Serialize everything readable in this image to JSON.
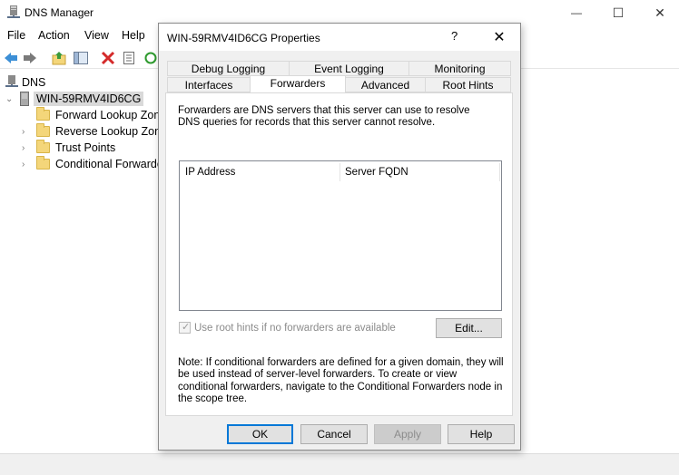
{
  "app": {
    "title": "DNS Manager",
    "min_glyph": "—",
    "max_glyph": "☐",
    "close_glyph": "✕"
  },
  "menu": [
    "File",
    "Action",
    "View",
    "Help"
  ],
  "tree": {
    "root": "DNS",
    "server": "WIN-59RMV4ID6CG",
    "folders": [
      "Forward Lookup Zones",
      "Reverse Lookup Zones",
      "Trust Points",
      "Conditional Forwarders"
    ]
  },
  "dialog": {
    "title": "WIN-59RMV4ID6CG Properties",
    "help_glyph": "?",
    "close_glyph": "✕",
    "tabs_row1": [
      "Debug Logging",
      "Event Logging",
      "Monitoring"
    ],
    "tabs_row2": [
      "Interfaces",
      "Forwarders",
      "Advanced",
      "Root Hints"
    ],
    "active_tab": "Forwarders",
    "description": "Forwarders are DNS servers that this server can use to resolve DNS queries for records that this server cannot resolve.",
    "columns": [
      "IP Address",
      "Server FQDN"
    ],
    "checkbox_label": "Use root hints if no forwarders are available",
    "checkbox_checked": true,
    "checkbox_enabled": false,
    "edit_button": "Edit...",
    "note": "Note: If conditional forwarders are defined for a given domain, they will be used instead of server-level forwarders.  To create or view conditional forwarders, navigate to the Conditional Forwarders node in the scope tree.",
    "buttons": {
      "ok": "OK",
      "cancel": "Cancel",
      "apply": "Apply",
      "help": "Help"
    }
  },
  "colors": {
    "accent": "#0078d7",
    "dialog_bg": "#f0f0f0",
    "selection": "#d9d9d9"
  }
}
